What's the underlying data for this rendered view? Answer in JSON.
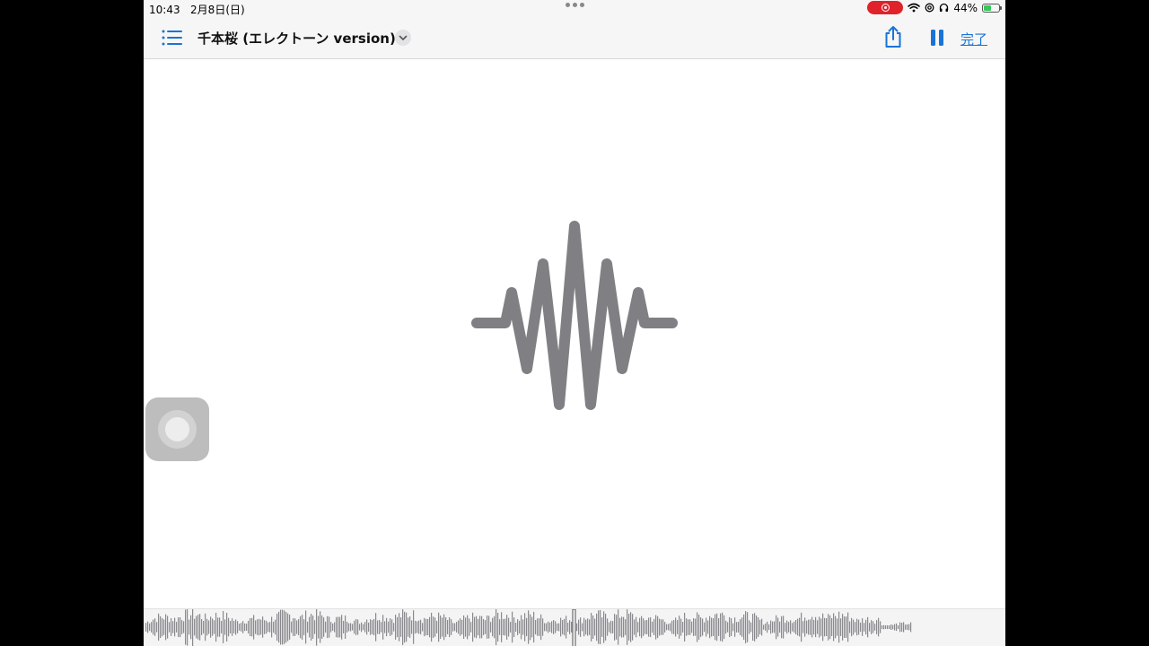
{
  "status_bar": {
    "time": "10:43",
    "date": "2月8日(日)",
    "battery_percent": "44%",
    "battery_level": 0.44,
    "recording_color": "#e0222b",
    "icons": [
      "screen-recording-icon",
      "wifi-icon",
      "at-icon",
      "headphones-icon",
      "battery-charging-icon"
    ]
  },
  "nav": {
    "menu_icon": "list-icon",
    "title": "千本桜 (エレクトーン version)",
    "dropdown_icon": "chevron-down-icon",
    "share_icon": "share-icon",
    "pause_icon": "pause-icon",
    "done_label": "完了",
    "accent_color": "#1a73d8"
  },
  "content": {
    "center_icon": "audio-waveform-icon",
    "icon_color": "#808084"
  },
  "assistive_touch": {
    "icon": "assistive-touch-icon"
  },
  "scrubber": {
    "waveform_color": "#8a8a8e",
    "playhead_position": 0.5
  }
}
